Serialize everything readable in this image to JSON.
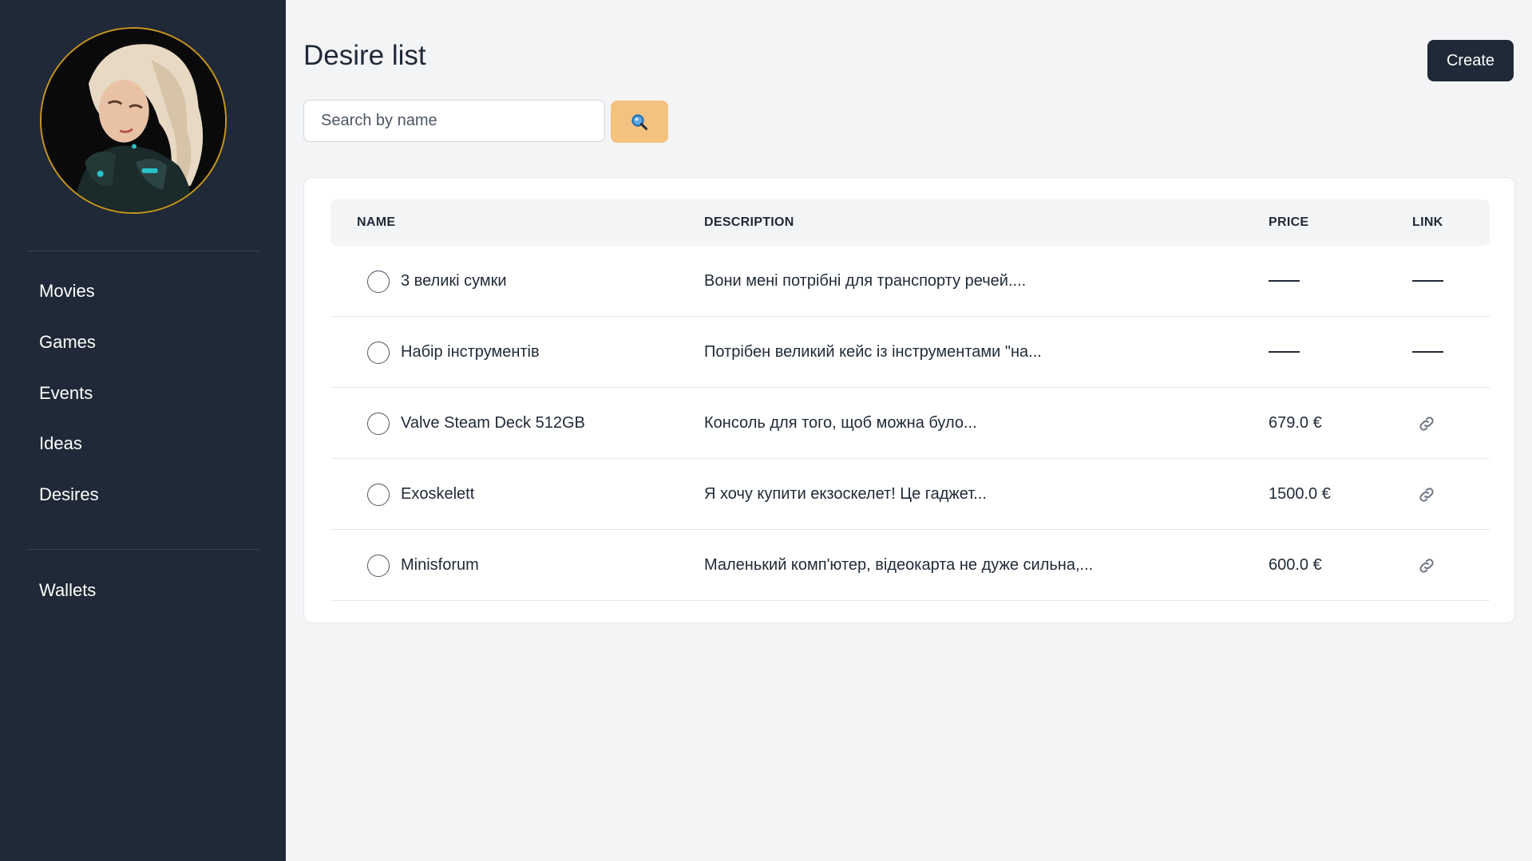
{
  "sidebar": {
    "items": [
      {
        "label": "Movies"
      },
      {
        "label": "Games"
      },
      {
        "label": "Events"
      },
      {
        "label": "Ideas"
      },
      {
        "label": "Desires"
      }
    ],
    "secondary_items": [
      {
        "label": "Wallets"
      }
    ]
  },
  "header": {
    "title": "Desire list",
    "create_label": "Create"
  },
  "search": {
    "placeholder": "Search by name",
    "value": "",
    "button_icon": "search-icon"
  },
  "table": {
    "columns": [
      "NAME",
      "DESCRIPTION",
      "PRICE",
      "LINK"
    ],
    "rows": [
      {
        "name": "3 великі сумки",
        "description": "Вони мені потрібні для транспорту речей....",
        "price": "",
        "has_link": false
      },
      {
        "name": "Набір інструментів",
        "description": "Потрібен великий кейс із інструментами \"на...",
        "price": "",
        "has_link": false
      },
      {
        "name": "Valve Steam Deck 512GB",
        "description": "Консоль для того, щоб можна було...",
        "price": "679.0 €",
        "has_link": true
      },
      {
        "name": "Exoskelett",
        "description": "Я хочу купити екзоскелет! Це гаджет...",
        "price": "1500.0 €",
        "has_link": true
      },
      {
        "name": "Minisforum",
        "description": "Маленький комп'ютер, відеокарта не дуже сильна,...",
        "price": "600.0 €",
        "has_link": true
      }
    ]
  },
  "colors": {
    "sidebar_bg": "#1f2937",
    "page_bg": "#f3f4f6",
    "search_button": "#f4c27f",
    "primary_button": "#1f2937",
    "avatar_border": "#c8961e"
  }
}
